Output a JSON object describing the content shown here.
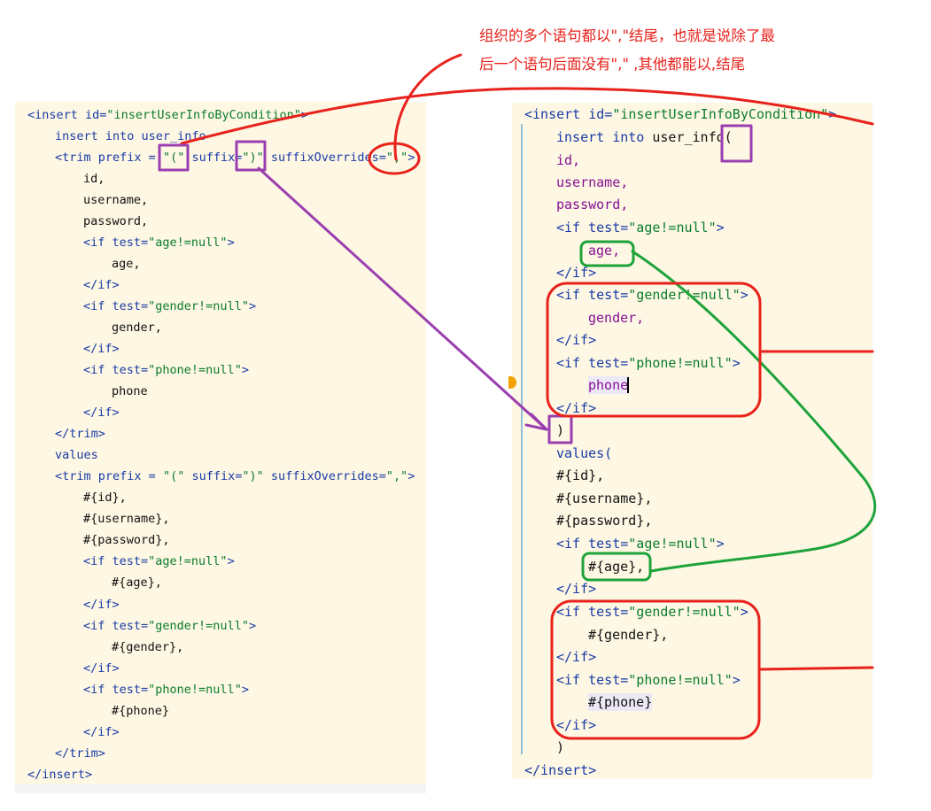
{
  "annotation": {
    "line1": "组织的多个语句都以\",\"结尾，也就是说除了最",
    "line2": "后一个语句后面没有\",\" ,其他都能以,结尾"
  },
  "left_code": {
    "l1": {
      "open": "<insert ",
      "attr": "id=",
      "str": "\"insertUserInfoByCondition\"",
      "close": ">"
    },
    "l2": "insert into user_info",
    "l3": {
      "open": "<trim ",
      "a1": "prefix = ",
      "s1": "\"(\"",
      "a2": " suffix=",
      "s2": "\")\"",
      "a3": " suffixOverrides=",
      "s3": "\",\"",
      "close": ">"
    },
    "l4": "id,",
    "l5": "username,",
    "l6": "password,",
    "l7": {
      "open": "<if ",
      "attr": "test=",
      "str": "\"age!=null\"",
      "close": ">"
    },
    "l8": "age,",
    "l9": "</if>",
    "l10": {
      "open": "<if ",
      "attr": "test=",
      "str": "\"gender!=null\"",
      "close": ">"
    },
    "l11": "gender,",
    "l12": "</if>",
    "l13": {
      "open": "<if ",
      "attr": "test=",
      "str": "\"phone!=null\"",
      "close": ">"
    },
    "l14": "phone",
    "l15": "</if>",
    "l16": "</trim>",
    "l17": "values",
    "l18": {
      "open": "<trim ",
      "a1": "prefix = ",
      "s1": "\"(\"",
      "a2": " suffix=",
      "s2": "\")\"",
      "a3": " suffixOverrides=",
      "s3": "\",\"",
      "close": ">"
    },
    "l19": "#{id},",
    "l20": "#{username},",
    "l21": "#{password},",
    "l22": {
      "open": "<if ",
      "attr": "test=",
      "str": "\"age!=null\"",
      "close": ">"
    },
    "l23": "#{age},",
    "l24": "</if>",
    "l25": {
      "open": "<if ",
      "attr": "test=",
      "str": "\"gender!=null\"",
      "close": ">"
    },
    "l26": "#{gender},",
    "l27": "</if>",
    "l28": {
      "open": "<if ",
      "attr": "test=",
      "str": "\"phone!=null\"",
      "close": ">"
    },
    "l29": "#{phone}",
    "l30": "</if>",
    "l31": "</trim>",
    "l32": "</insert>"
  },
  "right_code": {
    "r1": {
      "open": "<insert ",
      "attr": "id=",
      "str": "\"insertUserInfoByCondition\"",
      "close": ">"
    },
    "r2": {
      "kw": "insert into ",
      "plain": "user_info("
    },
    "r3": "id,",
    "r4": "username,",
    "r5": "password,",
    "r6": {
      "open": "<if ",
      "attr": "test=",
      "str": "\"age!=null\"",
      "close": ">"
    },
    "r7": "age,",
    "r8": "</if>",
    "r9": {
      "open": "<if ",
      "attr": "test=",
      "str": "\"gender!=null\"",
      "close": ">"
    },
    "r10": "gender,",
    "r11": "</if>",
    "r12": {
      "open": "<if ",
      "attr": "test=",
      "str": "\"phone!=null\"",
      "close": ">"
    },
    "r13": "phone",
    "r14": "</if>",
    "r15": ")",
    "r16": "values(",
    "r17": "#{id},",
    "r18": "#{username},",
    "r19": "#{password},",
    "r20": {
      "open": "<if ",
      "attr": "test=",
      "str": "\"age!=null\"",
      "close": ">"
    },
    "r21": "#{age},",
    "r22": "</if>",
    "r23": {
      "open": "<if ",
      "attr": "test=",
      "str": "\"gender!=null\"",
      "close": ">"
    },
    "r24": "#{gender},",
    "r25": "</if>",
    "r26": {
      "open": "<if ",
      "attr": "test=",
      "str": "\"phone!=null\"",
      "close": ">"
    },
    "r27": "#{phone}",
    "r28": "</if>",
    "r29": ")",
    "r30": "</insert>"
  },
  "colors": {
    "red": "#e8221c",
    "purple": "#9a3fb0",
    "green": "#1ea33a",
    "tag": "#1a3ba6",
    "string": "#0b7c2c",
    "field": "#871094"
  }
}
